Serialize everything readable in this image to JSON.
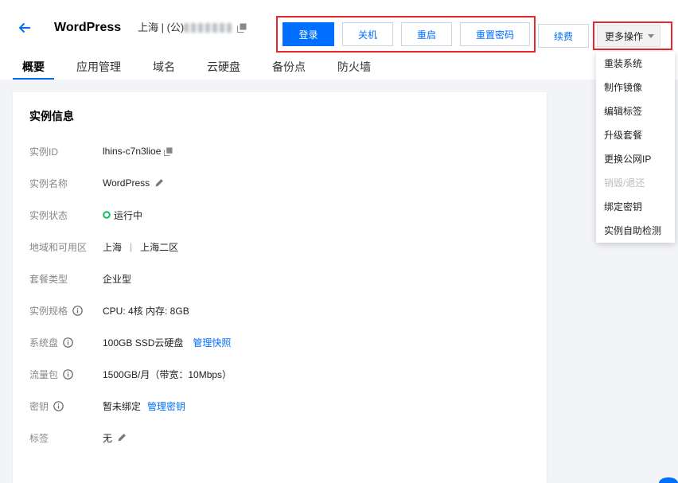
{
  "colors": {
    "primary": "#006eff",
    "annotation_red": "#e8262c",
    "status_running": "#0abf5b",
    "page_background": "#f3f4f7",
    "label_gray": "#888888"
  },
  "header": {
    "back_icon": "back-arrow-icon",
    "title": "WordPress",
    "region_ip": "上海 | (公)",
    "copy_icon": "copy-icon",
    "actions": [
      {
        "label": "登录"
      },
      {
        "label": "关机"
      },
      {
        "label": "重启"
      },
      {
        "label": "重置密码"
      }
    ],
    "renew_label": "续费",
    "more_label": "更多操作",
    "more_icon": "caret-down-icon"
  },
  "more_menu": {
    "items": [
      {
        "label": "重装系统",
        "disabled": false
      },
      {
        "label": "制作镜像",
        "disabled": false
      },
      {
        "label": "编辑标签",
        "disabled": false
      },
      {
        "label": "升级套餐",
        "disabled": false
      },
      {
        "label": "更换公网IP",
        "disabled": false
      },
      {
        "label": "销毁/退还",
        "disabled": true
      },
      {
        "label": "绑定密钥",
        "disabled": false
      },
      {
        "label": "实例自助检测",
        "disabled": false
      }
    ]
  },
  "tabs": [
    {
      "label": "概要",
      "active": true
    },
    {
      "label": "应用管理",
      "active": false
    },
    {
      "label": "域名",
      "active": false
    },
    {
      "label": "云硬盘",
      "active": false
    },
    {
      "label": "备份点",
      "active": false
    },
    {
      "label": "防火墙",
      "active": false
    }
  ],
  "instance_info": {
    "title": "实例信息",
    "instance_id": {
      "label": "实例ID",
      "value": "lhins-c7n3lioe",
      "icon": "copy-icon"
    },
    "instance_name": {
      "label": "实例名称",
      "value": "WordPress",
      "icon": "pencil-icon"
    },
    "status": {
      "label": "实例状态",
      "value": "运行中",
      "icon": "status-running-icon"
    },
    "region": {
      "label": "地域和可用区",
      "region": "上海",
      "separator": "|",
      "zone": "上海二区"
    },
    "plan_type": {
      "label": "套餐类型",
      "value": "企业型"
    },
    "spec": {
      "label": "实例规格",
      "value": "CPU: 4核 内存: 8GB",
      "icon": "info-icon"
    },
    "system_disk": {
      "label": "系统盘",
      "value": "100GB SSD云硬盘",
      "link": "管理快照",
      "icon": "info-icon"
    },
    "traffic": {
      "label": "流量包",
      "value": "1500GB/月（带宽：10Mbps）",
      "icon": "info-icon"
    },
    "key": {
      "label": "密钥",
      "value": "暂未绑定",
      "link": "管理密钥",
      "icon": "info-icon"
    },
    "tags": {
      "label": "标签",
      "value": "无",
      "icon": "pencil-icon"
    }
  }
}
